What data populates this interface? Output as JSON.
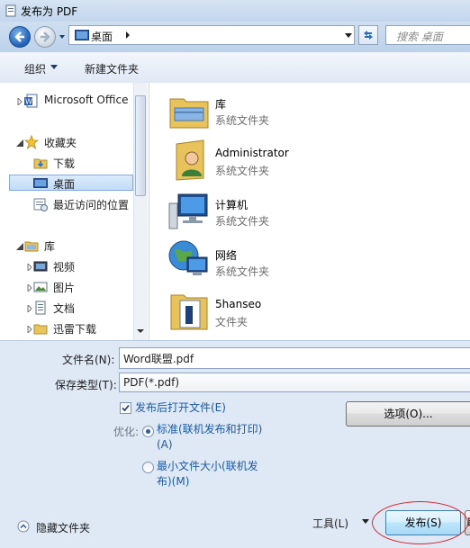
{
  "window": {
    "title": "发布为 PDF"
  },
  "address": {
    "location": "桌面",
    "search_placeholder": "搜索 桌面"
  },
  "toolbar": {
    "organize": "组织",
    "new_folder": "新建文件夹"
  },
  "nav": {
    "items": [
      {
        "label": "Microsoft Office",
        "icon": "word-icon"
      },
      {
        "label": "收藏夹",
        "icon": "star-icon"
      },
      {
        "label": "下载",
        "icon": "download-folder-icon"
      },
      {
        "label": "桌面",
        "icon": "desktop-icon"
      },
      {
        "label": "最近访问的位置",
        "icon": "recent-places-icon"
      },
      {
        "label": "库",
        "icon": "library-icon"
      },
      {
        "label": "视频",
        "icon": "video-library-icon"
      },
      {
        "label": "图片",
        "icon": "picture-library-icon"
      },
      {
        "label": "文档",
        "icon": "document-library-icon"
      },
      {
        "label": "迅雷下载",
        "icon": "folder-icon"
      }
    ]
  },
  "content": {
    "items": [
      {
        "name": "库",
        "type": "系统文件夹",
        "icon": "library-folder-icon"
      },
      {
        "name": "Administrator",
        "type": "系统文件夹",
        "icon": "user-folder-icon"
      },
      {
        "name": "计算机",
        "type": "系统文件夹",
        "icon": "computer-icon"
      },
      {
        "name": "网络",
        "type": "系统文件夹",
        "icon": "network-icon"
      },
      {
        "name": "5hanseo",
        "type": "文件夹",
        "icon": "folder-document-icon"
      }
    ]
  },
  "form": {
    "filename_label": "文件名(N):",
    "filename_value": "Word联盟.pdf",
    "type_label": "保存类型(T):",
    "type_value": "PDF(*.pdf)",
    "open_after_label": "发布后打开文件(E)",
    "open_after_checked": true,
    "optimize_label": "优化:",
    "option_standard_line1": "标准(联机发布和打印)",
    "option_standard_line2": "(A)",
    "option_min_line1": "最小文件大小(联机发",
    "option_min_line2": "布)(M)",
    "options_button": "选项(O)...",
    "hide_folders": "隐藏文件夹",
    "tools": "工具(L)",
    "publish": "发布(S)",
    "cancel_partial": "取"
  },
  "colors": {
    "link": "#1b5aa6",
    "highlight_ellipse": "#d8252c"
  }
}
